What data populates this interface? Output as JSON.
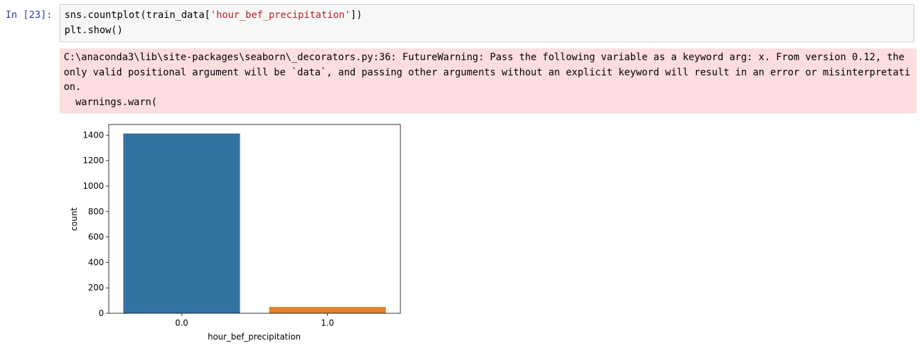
{
  "cell": {
    "prompt": "In [23]:",
    "code": {
      "line1_prefix": "sns.countplot(train_data[",
      "line1_string": "'hour_bef_precipitation'",
      "line1_suffix": "])",
      "line2": "plt.show()"
    }
  },
  "output": {
    "stderr": "C:\\anaconda3\\lib\\site-packages\\seaborn\\_decorators.py:36: FutureWarning: Pass the following variable as a keyword arg: x. From version 0.12, the only valid positional argument will be `data`, and passing other arguments without an explicit keyword will result in an error or misinterpretation.\n  warnings.warn("
  },
  "chart_data": {
    "type": "bar",
    "categories": [
      "0.0",
      "1.0"
    ],
    "values": [
      1413,
      50
    ],
    "colors": [
      "#3274a1",
      "#e1812c"
    ],
    "xlabel": "hour_bef_precipitation",
    "ylabel": "count",
    "ylim": [
      0,
      1484
    ],
    "yticks": [
      0,
      200,
      400,
      600,
      800,
      1000,
      1200,
      1400
    ],
    "grid": false
  }
}
